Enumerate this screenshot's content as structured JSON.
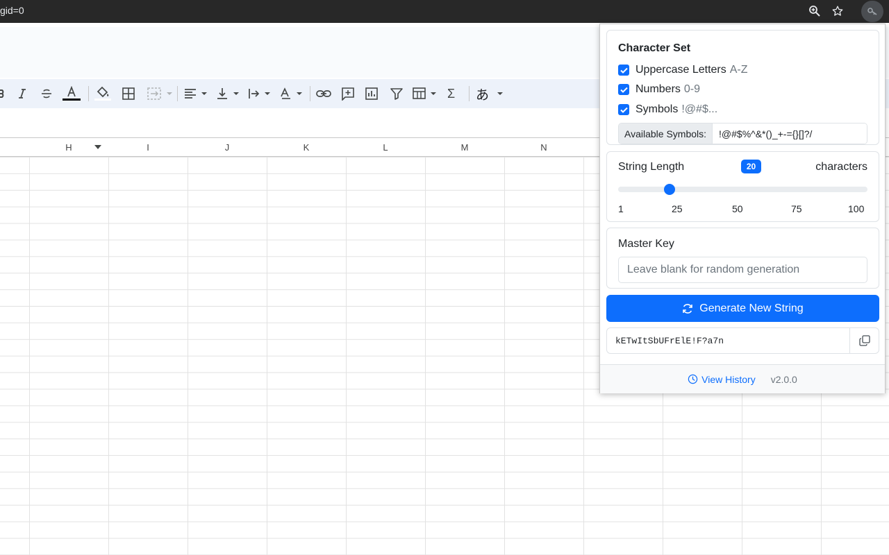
{
  "browser": {
    "url_fragment": "gid=0",
    "zoom_icon": "zoom-icon",
    "star_icon": "star-icon",
    "extension_icon": "extension-icon"
  },
  "sheet": {
    "columns": [
      "H",
      "I",
      "J",
      "K",
      "L",
      "M",
      "N"
    ],
    "toolbar_icons": [
      "italic-icon",
      "strikethrough-icon",
      "text-color-icon",
      "fill-color-icon",
      "borders-icon",
      "merge-cells-icon",
      "align-horizontal-icon",
      "align-vertical-icon",
      "text-wrap-icon",
      "text-rotation-icon",
      "link-icon",
      "comment-icon",
      "chart-icon",
      "filter-icon",
      "filter-views-icon",
      "functions-icon",
      "input-tools-icon"
    ],
    "input_tools_glyph": "あ",
    "functions_glyph": "Σ"
  },
  "popup": {
    "charset": {
      "title": "Character Set",
      "uppercase_label": "Uppercase Letters",
      "uppercase_hint": "A-Z",
      "numbers_label": "Numbers",
      "numbers_hint": "0-9",
      "symbols_label": "Symbols",
      "symbols_hint": "!@#$...",
      "available_label": "Available Symbols:",
      "available_value": "!@#$%^&*()_+-={}[]?/"
    },
    "length": {
      "label": "String Length",
      "value": "20",
      "unit": "characters",
      "min": 1,
      "max": 100,
      "ticks": [
        "1",
        "25",
        "50",
        "75",
        "100"
      ]
    },
    "master_key": {
      "label": "Master Key",
      "placeholder": "Leave blank for random generation",
      "value": ""
    },
    "generate_label": "Generate New String",
    "output": "kETwItSbUFrElE!F?a7n",
    "footer": {
      "history_label": "View History",
      "version": "v2.0.0"
    },
    "accent_color": "#0d6efd"
  }
}
